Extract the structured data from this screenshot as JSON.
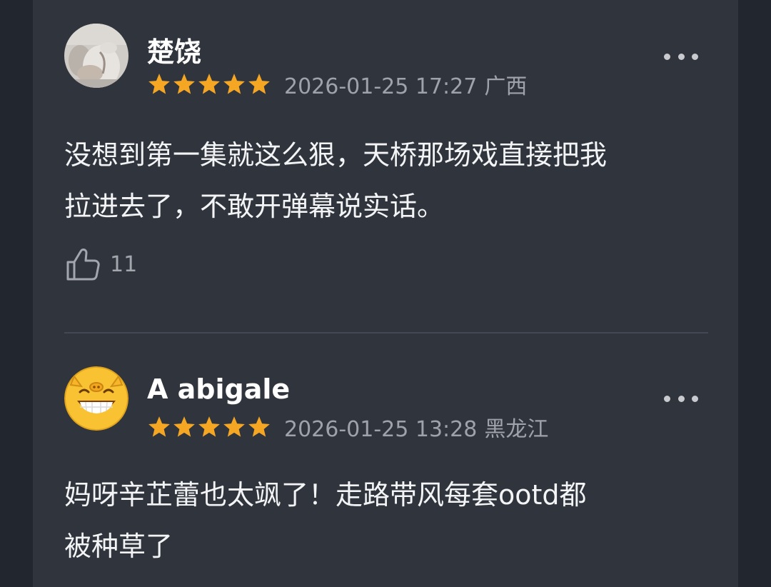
{
  "colors": {
    "page_background": "#22262f",
    "panel_background": "#30343d",
    "star": "#f5a623",
    "meta_text": "#9fa2aa",
    "divider": "#444852"
  },
  "reviews": [
    {
      "avatar_icon": "user-photo-avatar",
      "username": "楚饶",
      "rating": 5,
      "date": "2026-01-25 17:27",
      "location": "广西",
      "content_lines": [
        "没想到第一集就这么狠，天桥那场戏直接把我",
        "拉进去了，不敢开弹幕说实话。"
      ],
      "like_icon": "thumbs-up-icon",
      "likes": "11",
      "more_icon": "more-dots-icon"
    },
    {
      "avatar_icon": "grinning-pig-emoji-avatar",
      "username": "A abigale",
      "rating": 5,
      "date": "2026-01-25 13:28",
      "location": "黑龙江",
      "content_lines": [
        "妈呀辛芷蕾也太飒了！走路带风每套ootd都",
        "被种草了"
      ],
      "more_icon": "more-dots-icon"
    }
  ]
}
